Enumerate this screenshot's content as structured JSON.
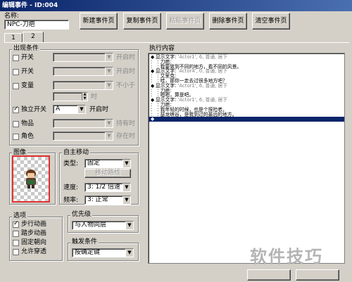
{
  "window": {
    "title": "编辑事件 - ID:004"
  },
  "name_field": {
    "label": "名称:",
    "value": "NPC-刀疤"
  },
  "toolbar": {
    "new_page": "新建事件页",
    "copy_page": "复制事件页",
    "paste_page": "粘贴事件页",
    "delete_page": "删除事件页",
    "clear_page": "清空事件页"
  },
  "tabs": [
    "1",
    "2"
  ],
  "conditions": {
    "title": "出现条件",
    "switch1": {
      "label": "开关",
      "suffix": "开启时"
    },
    "switch2": {
      "label": "开关",
      "suffix": "开启时"
    },
    "variable": {
      "label": "变量",
      "suffix": "不小于"
    },
    "variable_unit": "时",
    "self_switch": {
      "label": "独立开关",
      "value": "A",
      "suffix": "开启时"
    },
    "item": {
      "label": "物品",
      "suffix": "持有时"
    },
    "actor": {
      "label": "角色",
      "suffix": "存在时"
    }
  },
  "image": {
    "title": "图像"
  },
  "autonomous": {
    "title": "自主移动",
    "type_label": "类型:",
    "type_value": "固定",
    "route_button": "移动路线",
    "speed_label": "速度:",
    "speed_value": "3: 1/2 倍速",
    "freq_label": "频率:",
    "freq_value": "3: 正常"
  },
  "options": {
    "title": "选项",
    "walk_anim": "步行动画",
    "step_anim": "踏步动画",
    "dir_fix": "固定朝向",
    "through": "允许穿透"
  },
  "priority": {
    "title": "优先级",
    "value": "与人物同层"
  },
  "trigger": {
    "title": "触发条件",
    "value": "按确定键"
  },
  "contents": {
    "title": "执行内容",
    "rows": [
      {
        "mark": "◆",
        "text": "显示文字:",
        "param": "'Actor1', 6, 普通, 居下"
      },
      {
        "mark": ":",
        "text": "        :  刀疤:",
        "param": ""
      },
      {
        "mark": ":",
        "text": "        :  我要致到不同的地方，看不同的风景。",
        "param": ""
      },
      {
        "mark": "◆",
        "text": "显示文字:",
        "param": "'Actor4', 0, 普通, 居下"
      },
      {
        "mark": ":",
        "text": "        :  艾里克:",
        "param": ""
      },
      {
        "mark": ":",
        "text": "        :  哇，那你一走去过很多地方吧？",
        "param": ""
      },
      {
        "mark": "◆",
        "text": "显示文字:",
        "param": "'Actor1', 6, 普通, 居下"
      },
      {
        "mark": ":",
        "text": "        :  刀疤:",
        "param": ""
      },
      {
        "mark": ":",
        "text": "        :  嗯嗯，算是吧。",
        "param": ""
      },
      {
        "mark": "◆",
        "text": "显示文字:",
        "param": "'Actor1', 6, 普通, 居下"
      },
      {
        "mark": ":",
        "text": "        :  刀疤:",
        "param": ""
      },
      {
        "mark": ":",
        "text": "        :  我年轻的时候，也是个探险者。",
        "param": ""
      },
      {
        "mark": ":",
        "text": "        :  瑟龙峡谷，是我到过的最远的地方。",
        "param": ""
      },
      {
        "mark": "◆",
        "text": "",
        "param": "",
        "selected": true
      }
    ]
  },
  "watermark": "软件技巧"
}
